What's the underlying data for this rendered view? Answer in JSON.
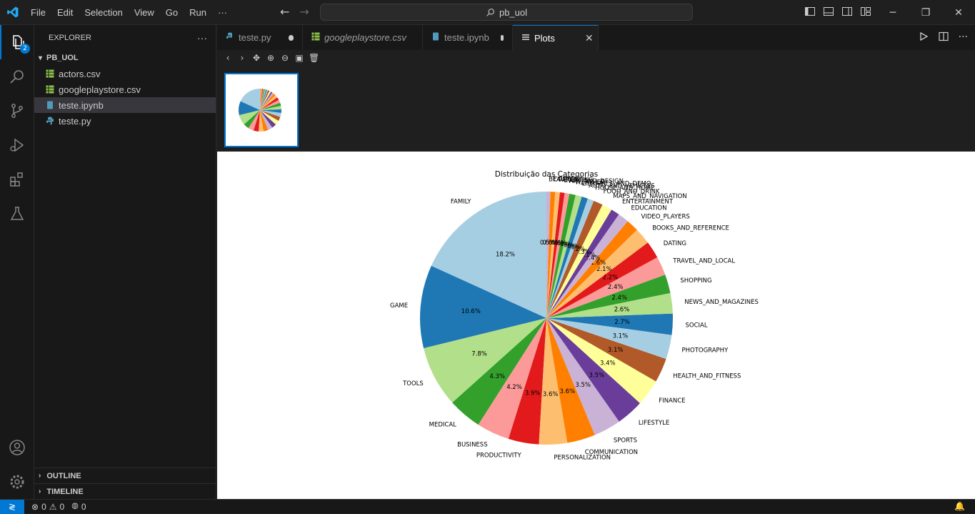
{
  "titlebar": {
    "menu": [
      "File",
      "Edit",
      "Selection",
      "View",
      "Go",
      "Run",
      "···"
    ],
    "search": "pb_uol"
  },
  "activity": {
    "badge": "2"
  },
  "sidebar": {
    "title": "EXPLORER",
    "more": "···",
    "folder": "PB_UOL",
    "files": [
      {
        "name": "actors.csv",
        "type": "csv"
      },
      {
        "name": "googleplaystore.csv",
        "type": "csv"
      },
      {
        "name": "teste.ipynb",
        "type": "ipynb"
      },
      {
        "name": "teste.py",
        "type": "py"
      }
    ],
    "outline": "OUTLINE",
    "timeline": "TIMELINE"
  },
  "tabs": [
    {
      "label": "teste.py",
      "state": "dirty"
    },
    {
      "label": "googleplaystore.csv",
      "state": "normal"
    },
    {
      "label": "teste.ipynb",
      "state": "dirty"
    },
    {
      "label": "Plots",
      "state": "active"
    }
  ],
  "statusbar": {
    "errors": "0",
    "warnings": "0",
    "ports": "0"
  },
  "colors": {
    "accent": "#0078d4",
    "csv": "#8bc34a",
    "ipynb": "#519aba",
    "py": "#519aba"
  },
  "chart_data": {
    "type": "pie",
    "title": "Distribuição das Categorias",
    "start_angle_deg": 90,
    "counterclockwise": true,
    "colors": [
      "#a6cee3",
      "#1f78b4",
      "#b2df8a",
      "#33a02c",
      "#fb9a99",
      "#e31a1c",
      "#fdbf6f",
      "#ff7f00",
      "#cab2d6",
      "#6a3d9a",
      "#ffff99",
      "#b15928"
    ],
    "categories": [
      "FAMILY",
      "GAME",
      "TOOLS",
      "MEDICAL",
      "BUSINESS",
      "PRODUCTIVITY",
      "PERSONALIZATION",
      "COMMUNICATION",
      "SPORTS",
      "LIFESTYLE",
      "FINANCE",
      "HEALTH_AND_FITNESS",
      "PHOTOGRAPHY",
      "SOCIAL",
      "NEWS_AND_MAGAZINES",
      "SHOPPING",
      "TRAVEL_AND_LOCAL",
      "DATING",
      "BOOKS_AND_REFERENCE",
      "VIDEO_PLAYERS",
      "EDUCATION",
      "ENTERTAINMENT",
      "MAPS_AND_NAVIGATION",
      "FOOD_AND_DRINK",
      "HOUSE_AND_HOME",
      "AUTO_AND_VEHICLES",
      "LIBRARIES_AND_DEMO",
      "WEATHER",
      "ART_AND_DESIGN",
      "EVENTS",
      "PARENTING",
      "COMICS",
      "BEAUTY"
    ],
    "values": [
      18.2,
      10.6,
      7.8,
      4.3,
      4.2,
      3.9,
      3.6,
      3.6,
      3.5,
      3.5,
      3.4,
      3.1,
      3.1,
      2.7,
      2.6,
      2.4,
      2.4,
      2.2,
      2.1,
      1.6,
      1.4,
      1.1,
      1.3,
      1.2,
      0.8,
      0.8,
      0.8,
      0.8,
      0.6,
      0.6,
      0.6,
      0.6,
      0.5
    ],
    "value_labels": [
      "18.2%",
      "10.6%",
      "7.8%",
      "4.3%",
      "4.2%",
      "3.9%",
      "3.6%",
      "3.6%",
      "3.5%",
      "3.5%",
      "3.4%",
      "3.1%",
      "3.1%",
      "2.7%",
      "2.6%",
      "2.4%",
      "2.4%",
      "2.2%",
      "2.1%",
      "1.6%",
      "1.4%",
      "1.1%",
      "1.3%",
      "1.2%",
      "0.8%",
      "0.8%",
      "0.8%",
      "0.8%",
      "0.6%",
      "0.6%",
      "0.6%",
      "0.6%",
      "0.5%"
    ]
  }
}
